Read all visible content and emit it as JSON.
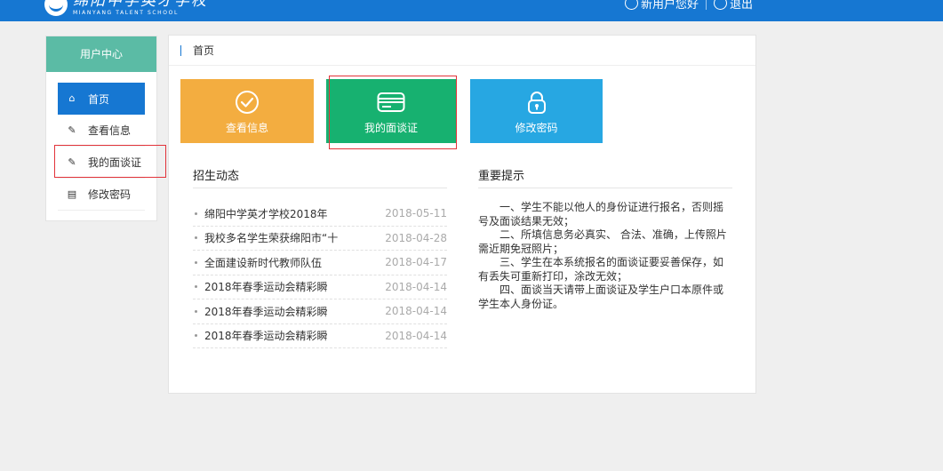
{
  "header": {
    "logo_cn": "绵阳中学英才学校",
    "logo_en": "MIANYANG TALENT SCHOOL",
    "greeting": "新用户您好",
    "logout": "退出"
  },
  "sidebar": {
    "title": "用户中心",
    "items": [
      {
        "label": "首页",
        "icon": "home-icon"
      },
      {
        "label": "查看信息",
        "icon": "edit-icon"
      },
      {
        "label": "我的面谈证",
        "icon": "edit-icon"
      },
      {
        "label": "修改密码",
        "icon": "document-icon"
      }
    ]
  },
  "breadcrumb": {
    "current": "首页"
  },
  "tiles": [
    {
      "label": "查看信息",
      "icon": "check-circle-icon",
      "color": "#f3ad40"
    },
    {
      "label": "我的面谈证",
      "icon": "id-card-icon",
      "color": "#17b170"
    },
    {
      "label": "修改密码",
      "icon": "lock-icon",
      "color": "#27a7e2"
    }
  ],
  "news": {
    "title": "招生动态",
    "items": [
      {
        "title": "绵阳中学英才学校2018年",
        "date": "2018-05-11"
      },
      {
        "title": "我校多名学生荣获绵阳市“十",
        "date": "2018-04-28"
      },
      {
        "title": "全面建设新时代教师队伍",
        "date": "2018-04-17"
      },
      {
        "title": "2018年春季运动会精彩瞬",
        "date": "2018-04-14"
      },
      {
        "title": "2018年春季运动会精彩瞬",
        "date": "2018-04-14"
      },
      {
        "title": "2018年春季运动会精彩瞬",
        "date": "2018-04-14"
      }
    ]
  },
  "tips": {
    "title": "重要提示",
    "paragraphs": [
      "一、学生不能以他人的身份证进行报名，否则摇号及面谈结果无效；",
      "二、所填信息务必真实、 合法、准确，上传照片需近期免冠照片；",
      "三、学生在本系统报名的面谈证要妥善保存，如有丢失可重新打印，涂改无效；",
      "四、面谈当天请带上面谈证及学生户口本原件或学生本人身份证。"
    ]
  }
}
